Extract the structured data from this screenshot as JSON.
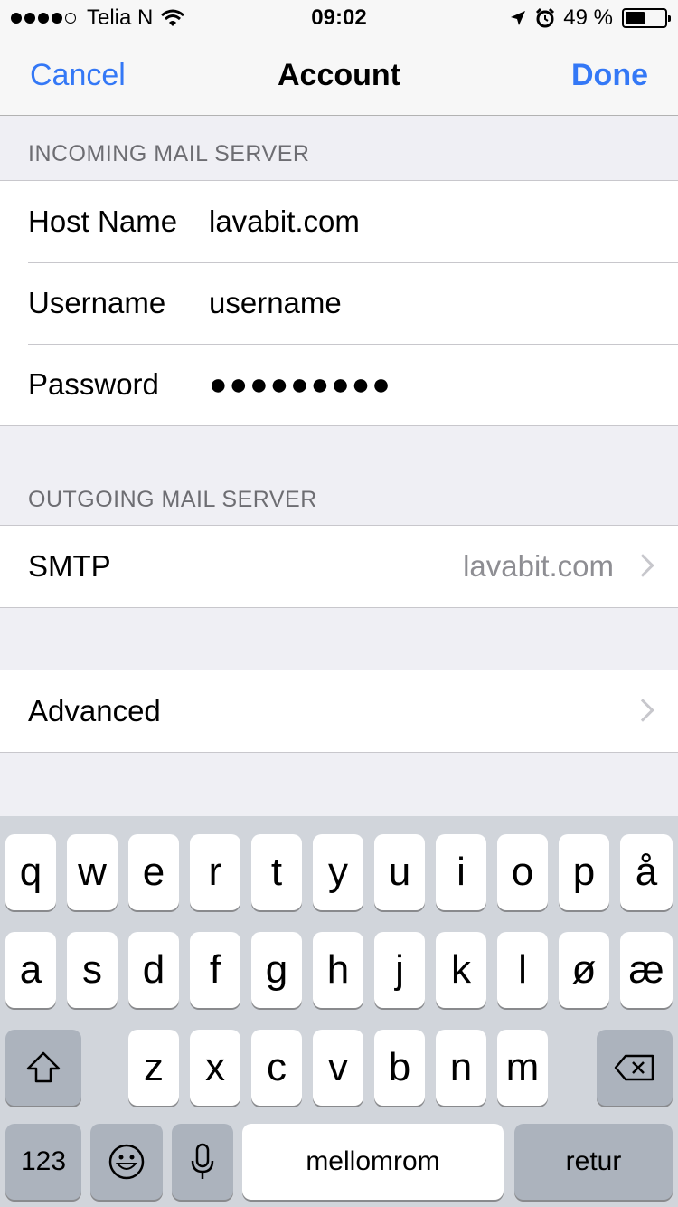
{
  "status_bar": {
    "carrier": "Telia N",
    "time": "09:02",
    "battery": "49 %",
    "battery_level": 0.49,
    "icons": [
      "signal-dots",
      "wifi-icon",
      "location-arrow-icon",
      "alarm-icon",
      "battery-icon"
    ]
  },
  "nav": {
    "cancel_label": "Cancel",
    "title": "Account",
    "done_label": "Done"
  },
  "incoming": {
    "header": "INCOMING MAIL SERVER",
    "rows": [
      {
        "label": "Host Name",
        "value": "lavabit.com"
      },
      {
        "label": "Username",
        "value": "username"
      },
      {
        "label": "Password",
        "value": "●●●●●●●●●"
      }
    ]
  },
  "outgoing": {
    "header": "OUTGOING MAIL SERVER",
    "smtp_label": "SMTP",
    "smtp_value": "lavabit.com"
  },
  "advanced": {
    "label": "Advanced"
  },
  "keyboard": {
    "row1": [
      "q",
      "w",
      "e",
      "r",
      "t",
      "y",
      "u",
      "i",
      "o",
      "p",
      "å"
    ],
    "row2": [
      "a",
      "s",
      "d",
      "f",
      "g",
      "h",
      "j",
      "k",
      "l",
      "ø",
      "æ"
    ],
    "row3": [
      "z",
      "x",
      "c",
      "v",
      "b",
      "n",
      "m"
    ],
    "numbers_label": "123",
    "space_label": "mellomrom",
    "return_label": "retur"
  },
  "colors": {
    "accent": "#3478f6",
    "background": "#efeff4",
    "keyboard_bg": "#d1d5db",
    "function_key": "#acb3bd"
  }
}
